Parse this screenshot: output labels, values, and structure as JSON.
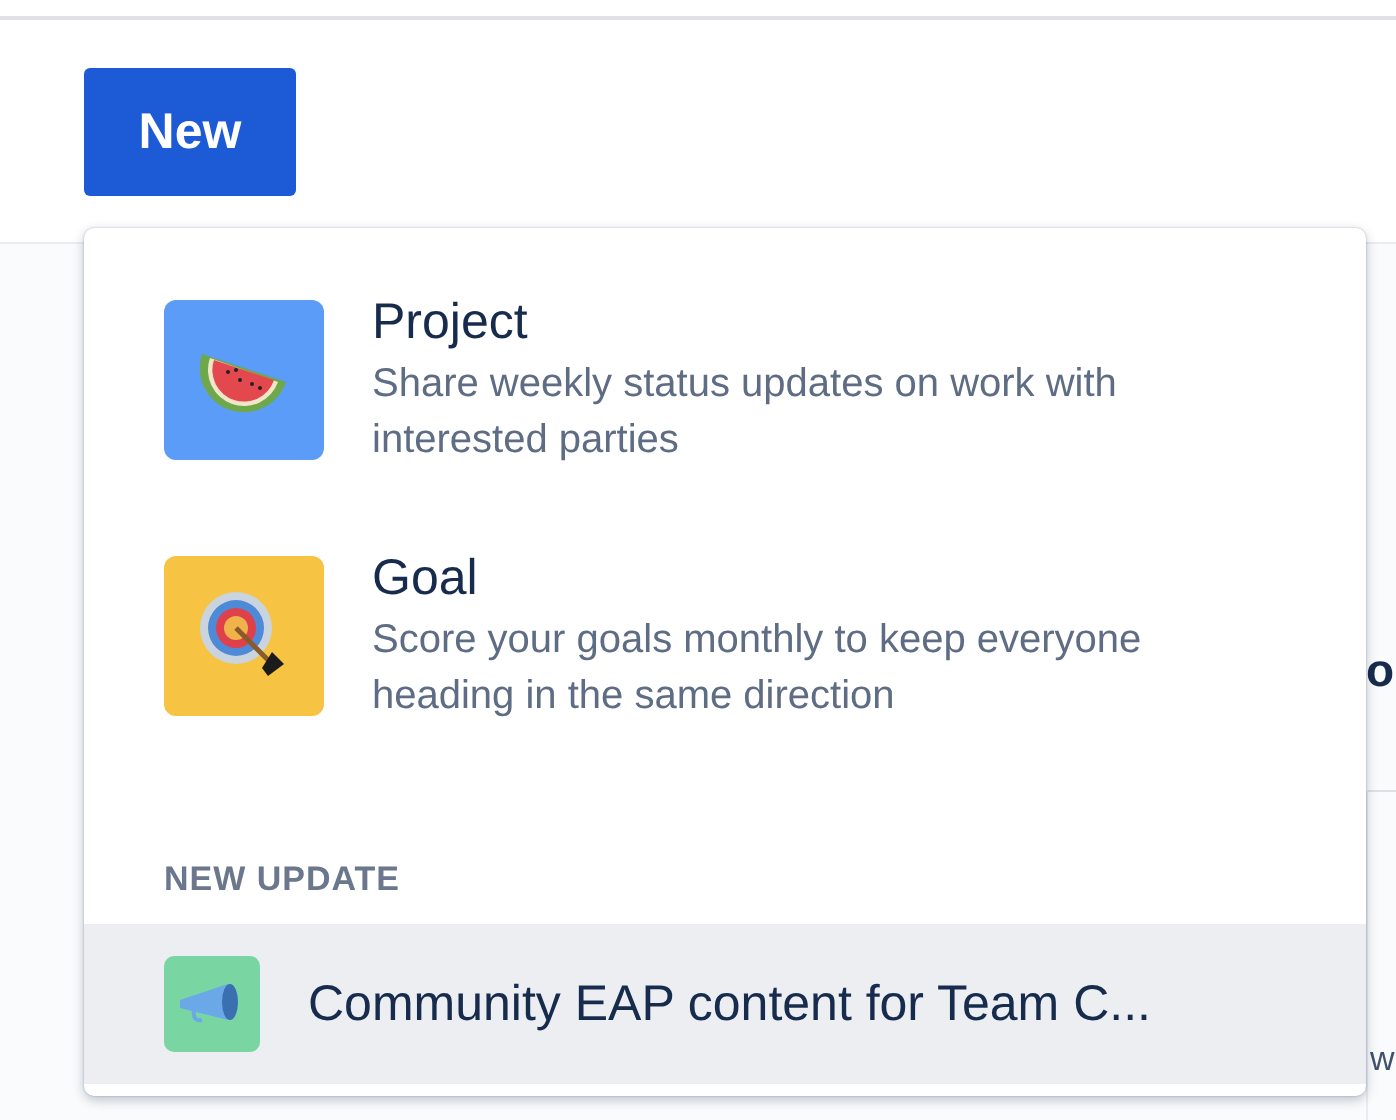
{
  "new_button": {
    "label": "New"
  },
  "menu": {
    "items": [
      {
        "kind": "project",
        "title": "Project",
        "description": "Share weekly status updates on work with interested parties"
      },
      {
        "kind": "goal",
        "title": "Goal",
        "description": "Score your goals monthly to keep everyone heading in the same direction"
      }
    ],
    "section_heading": "NEW UPDATE",
    "updates": [
      {
        "title": "Community EAP content for Team C...",
        "selected": true
      }
    ]
  },
  "background": {
    "heading_fragment": "o",
    "text_fragment": "w"
  }
}
